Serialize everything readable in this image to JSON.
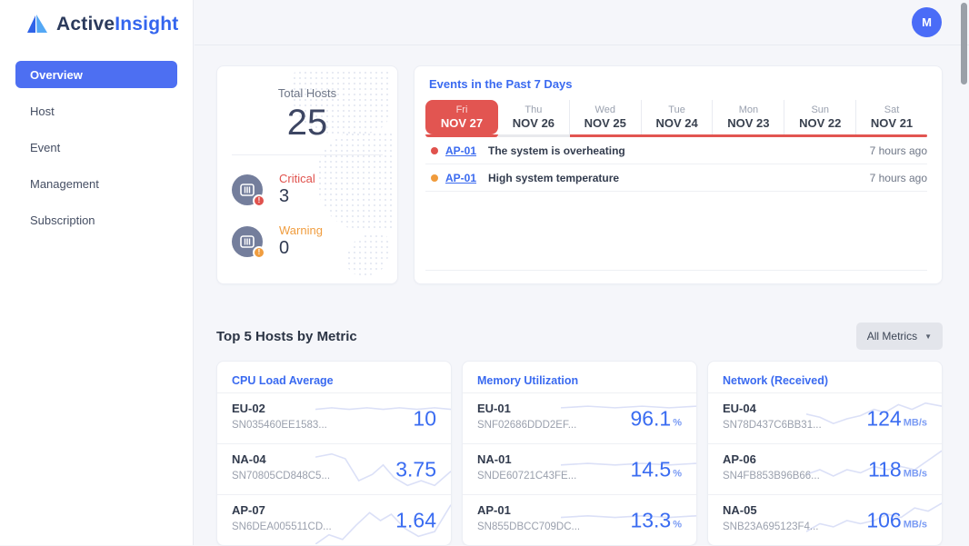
{
  "app": {
    "brand_active": "Active",
    "brand_insight": "Insight",
    "avatar_initial": "M"
  },
  "colors": {
    "accent_blue": "#3a6af0",
    "active_nav": "#4d6ff2",
    "critical": "#e0524d",
    "warning": "#f09d3f",
    "tab_red": "#e25551"
  },
  "sidebar": {
    "items": [
      {
        "label": "Overview",
        "active": true
      },
      {
        "label": "Host",
        "active": false
      },
      {
        "label": "Event",
        "active": false
      },
      {
        "label": "Management",
        "active": false
      },
      {
        "label": "Subscription",
        "active": false
      }
    ]
  },
  "summary": {
    "title": "Total Hosts",
    "total": "25",
    "stats": [
      {
        "label": "Critical",
        "value": "3",
        "color": "#e0524d"
      },
      {
        "label": "Warning",
        "value": "0",
        "color": "#f09d3f"
      }
    ]
  },
  "events": {
    "title": "Events in the Past 7 Days",
    "days": [
      {
        "day": "Fri",
        "date": "NOV 27",
        "active": true
      },
      {
        "day": "Thu",
        "date": "NOV 26",
        "active": false
      },
      {
        "day": "Wed",
        "date": "NOV 25",
        "active": false
      },
      {
        "day": "Tue",
        "date": "NOV 24",
        "active": false
      },
      {
        "day": "Mon",
        "date": "NOV 23",
        "active": false
      },
      {
        "day": "Sun",
        "date": "NOV 22",
        "active": false
      },
      {
        "day": "Sat",
        "date": "NOV 21",
        "active": false
      }
    ],
    "rows": [
      {
        "dot_color": "#e0524d",
        "host": "AP-01",
        "message": "The system is overheating",
        "time": "7 hours ago"
      },
      {
        "dot_color": "#f09b3c",
        "host": "AP-01",
        "message": "High system temperature",
        "time": "7 hours ago"
      }
    ]
  },
  "metrics_section": {
    "title": "Top 5 Hosts by Metric",
    "filter_label": "All Metrics"
  },
  "metric_cards": [
    {
      "title": "CPU Load Average",
      "rows": [
        {
          "host": "EU-02",
          "serial": "SN035460EE1583...",
          "value": "10",
          "unit": "",
          "spark": [
            [
              0,
              9
            ],
            [
              12,
              8
            ],
            [
              25,
              9
            ],
            [
              38,
              8
            ],
            [
              50,
              9
            ],
            [
              62,
              8
            ],
            [
              75,
              9
            ],
            [
              88,
              8
            ],
            [
              100,
              9
            ]
          ]
        },
        {
          "host": "NA-04",
          "serial": "SN70805CD848C5...",
          "value": "3.75",
          "unit": "",
          "spark": [
            [
              0,
              7
            ],
            [
              12,
              5
            ],
            [
              22,
              8
            ],
            [
              32,
              22
            ],
            [
              42,
              18
            ],
            [
              50,
              12
            ],
            [
              58,
              20
            ],
            [
              68,
              25
            ],
            [
              78,
              22
            ],
            [
              88,
              25
            ],
            [
              100,
              16
            ]
          ]
        },
        {
          "host": "AP-07",
          "serial": "SN6DEA005511CD...",
          "value": "1.64",
          "unit": "",
          "spark": [
            [
              0,
              30
            ],
            [
              10,
              24
            ],
            [
              20,
              27
            ],
            [
              30,
              18
            ],
            [
              40,
              10
            ],
            [
              48,
              15
            ],
            [
              56,
              11
            ],
            [
              66,
              20
            ],
            [
              76,
              25
            ],
            [
              88,
              22
            ],
            [
              100,
              5
            ]
          ]
        }
      ]
    },
    {
      "title": "Memory Utilization",
      "rows": [
        {
          "host": "EU-01",
          "serial": "SNF02686DDD2EF...",
          "value": "96.1",
          "unit": "%",
          "spark": [
            [
              0,
              8
            ],
            [
              20,
              7
            ],
            [
              40,
              8
            ],
            [
              60,
              7
            ],
            [
              80,
              8
            ],
            [
              100,
              7
            ]
          ]
        },
        {
          "host": "NA-01",
          "serial": "SNDE60721C43FE...",
          "value": "14.5",
          "unit": "%",
          "spark": [
            [
              0,
              12
            ],
            [
              20,
              11
            ],
            [
              40,
              12
            ],
            [
              60,
              11
            ],
            [
              80,
              12
            ],
            [
              100,
              11
            ]
          ]
        },
        {
          "host": "AP-01",
          "serial": "SN855DBCC709DC...",
          "value": "13.3",
          "unit": "%",
          "spark": [
            [
              0,
              13
            ],
            [
              20,
              12
            ],
            [
              40,
              13
            ],
            [
              60,
              12
            ],
            [
              80,
              13
            ],
            [
              100,
              12
            ]
          ]
        }
      ]
    },
    {
      "title": "Network (Received)",
      "rows": [
        {
          "host": "EU-04",
          "serial": "SN78D437C6BB31...",
          "value": "124",
          "unit": "MB/s",
          "spark": [
            [
              0,
              12
            ],
            [
              10,
              14
            ],
            [
              20,
              18
            ],
            [
              30,
              15
            ],
            [
              40,
              13
            ],
            [
              50,
              9
            ],
            [
              58,
              11
            ],
            [
              68,
              6
            ],
            [
              78,
              9
            ],
            [
              88,
              5
            ],
            [
              100,
              7
            ]
          ]
        },
        {
          "host": "AP-06",
          "serial": "SN4FB853B96B66...",
          "value": "118",
          "unit": "MB/s",
          "spark": [
            [
              0,
              18
            ],
            [
              10,
              15
            ],
            [
              20,
              19
            ],
            [
              30,
              15
            ],
            [
              40,
              17
            ],
            [
              50,
              13
            ],
            [
              60,
              15
            ],
            [
              70,
              13
            ],
            [
              80,
              15
            ],
            [
              90,
              9
            ],
            [
              100,
              3
            ]
          ]
        },
        {
          "host": "NA-05",
          "serial": "SNB23A695123F4...",
          "value": "106",
          "unit": "MB/s",
          "spark": [
            [
              0,
              22
            ],
            [
              10,
              17
            ],
            [
              20,
              19
            ],
            [
              30,
              15
            ],
            [
              40,
              17
            ],
            [
              50,
              15
            ],
            [
              60,
              11
            ],
            [
              70,
              13
            ],
            [
              80,
              7
            ],
            [
              90,
              9
            ],
            [
              100,
              4
            ]
          ]
        }
      ]
    }
  ]
}
